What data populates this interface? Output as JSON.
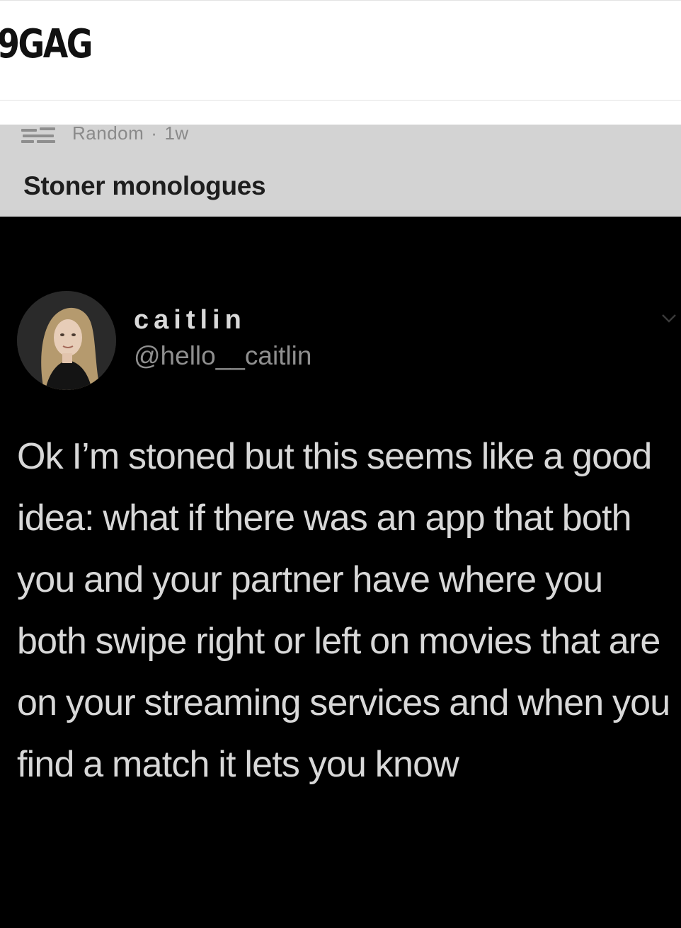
{
  "app": {
    "logo": "9GAG"
  },
  "post": {
    "section": "Random",
    "separator": "·",
    "age": "1w",
    "title": "Stoner monologues"
  },
  "tweet": {
    "display_name": "caitlin",
    "handle": "@hello__caitlin",
    "text": "Ok I’m stoned but this seems like a good idea: what if there was an app that both you and your partner have where you both swipe right or left on movies that are on your streaming services and when you find a match it lets you know"
  },
  "colors": {
    "header_bg": "#d3d3d3",
    "tweet_bg": "#000000",
    "tweet_text": "#d8d8d8",
    "handle_text": "#8f8f8f"
  }
}
